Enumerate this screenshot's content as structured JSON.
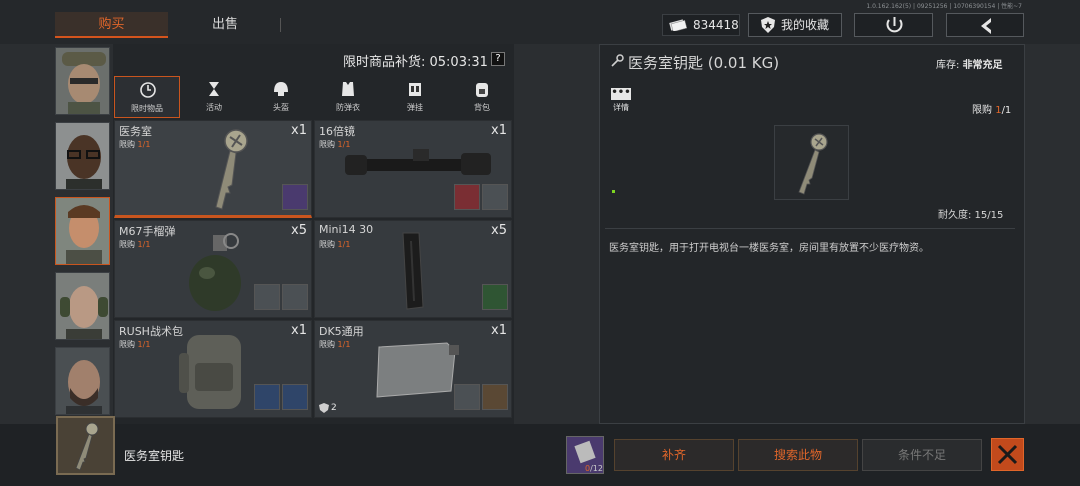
{
  "top": {
    "version": "1.0.162.162(5) | 09251256 | 10706390154 | 性能~7",
    "tabs": [
      "购买",
      "出售"
    ],
    "currency": "834418",
    "favorites_label": "我的收藏"
  },
  "shop": {
    "refresh_label": "限时商品补货: 05:03:31",
    "help": "?",
    "categories": [
      {
        "label": "限时物品",
        "icon": "clock-icon"
      },
      {
        "label": "活动",
        "icon": "event-icon"
      },
      {
        "label": "头盔",
        "icon": "helmet-icon"
      },
      {
        "label": "防弹衣",
        "icon": "vest-icon"
      },
      {
        "label": "弹挂",
        "icon": "rig-icon"
      },
      {
        "label": "背包",
        "icon": "backpack-icon"
      }
    ],
    "items": [
      {
        "name": "医务室",
        "limit_prefix": "限购 ",
        "limit": "1/1",
        "qty": "x1"
      },
      {
        "name": "16倍镜",
        "limit_prefix": "限购 ",
        "limit": "1/1",
        "qty": "x1"
      },
      {
        "name": "M67手榴弹",
        "limit_prefix": "限购 ",
        "limit": "1/1",
        "qty": "x5"
      },
      {
        "name": "Mini14 30",
        "limit_prefix": "限购 ",
        "limit": "1/1",
        "qty": "x5"
      },
      {
        "name": "RUSH战术包",
        "limit_prefix": "限购 ",
        "limit": "1/1",
        "qty": "x1"
      },
      {
        "name": "DK5通用",
        "limit_prefix": "限购 ",
        "limit": "1/1",
        "qty": "x1",
        "badge": "2"
      }
    ]
  },
  "detail": {
    "title": "医务室钥匙 (0.01 KG)",
    "stock_label": "库存: ",
    "stock_value": "非常充足",
    "tab_label": "详情",
    "tab_dots": "•••",
    "limit_prefix": "限购 ",
    "limit_value": "1",
    "limit_total": "/1",
    "durability": "耐久度: 15/15",
    "description": "医务室钥匙，用于打开电视台一楼医务室，房间里有放置不少医疗物资。"
  },
  "bottom": {
    "selected_name": "医务室钥匙",
    "cost_have": "0",
    "cost_total": "/12",
    "buttons": [
      "补齐",
      "搜索此物",
      "条件不足"
    ]
  },
  "colors": {
    "accent": "#e0662a",
    "panel": "#232629",
    "bg": "#2b2e31"
  }
}
